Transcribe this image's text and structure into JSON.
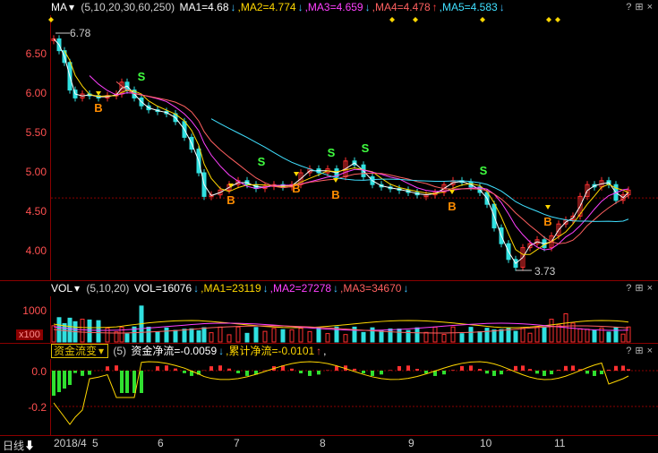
{
  "price_panel": {
    "title": "MA",
    "title_arrow": "▾",
    "params": "(5,10,20,30,60,250)",
    "ma_labels": [
      {
        "text": "MA1=4.68",
        "arrow": "↓",
        "color": "#ffffff"
      },
      {
        "text": ",MA2=4.774",
        "arrow": "↓",
        "color": "#ffd700"
      },
      {
        "text": ",MA3=4.659",
        "arrow": "↓",
        "color": "#ff40ff"
      },
      {
        "text": ",MA4=4.478",
        "arrow": "↑",
        "color": "#ff6060"
      },
      {
        "text": ",MA5=4.583",
        "arrow": "↓",
        "color": "#40e0ff"
      }
    ],
    "controls": "?⊞×",
    "yticks": [
      "6.50",
      "6.00",
      "5.50",
      "5.00",
      "4.50",
      "4.00"
    ],
    "high_label": "6.78",
    "low_label": "3.73",
    "signals": [
      "B",
      "S"
    ]
  },
  "volume_panel": {
    "title": "VOL",
    "title_arrow": "▾",
    "params": "(5,10,20)",
    "labels": [
      {
        "text": "VOL=16076",
        "arrow": "↓",
        "color": "#ffffff"
      },
      {
        "text": ",MA1=23119",
        "arrow": "↓",
        "color": "#ffd700"
      },
      {
        "text": ",MA2=27278",
        "arrow": "↓",
        "color": "#ff40ff"
      },
      {
        "text": ",MA3=34670",
        "arrow": "↓",
        "color": "#ff6060"
      }
    ],
    "controls": "?⊞×",
    "ytick": "1000",
    "unit": "x100"
  },
  "flow_panel": {
    "title": "资金流变",
    "title_arrow": "▾",
    "params": "(5)",
    "labels": [
      {
        "text": "资金净流=-0.0059",
        "arrow": "↓",
        "color": "#ffffff"
      },
      {
        "text": ",累计净流=-0.0101",
        "arrow": "↑",
        "color": "#ffd700"
      },
      {
        "text": ",",
        "arrow": "",
        "color": "#ffffff"
      }
    ],
    "controls": "?⊞×",
    "yticks": [
      "0.0",
      "-0.2"
    ]
  },
  "xaxis": {
    "period_button": "日线",
    "period_arrow": "⬇",
    "labels": [
      "2018/4",
      "5",
      "6",
      "7",
      "8",
      "9",
      "10",
      "11"
    ]
  }
}
